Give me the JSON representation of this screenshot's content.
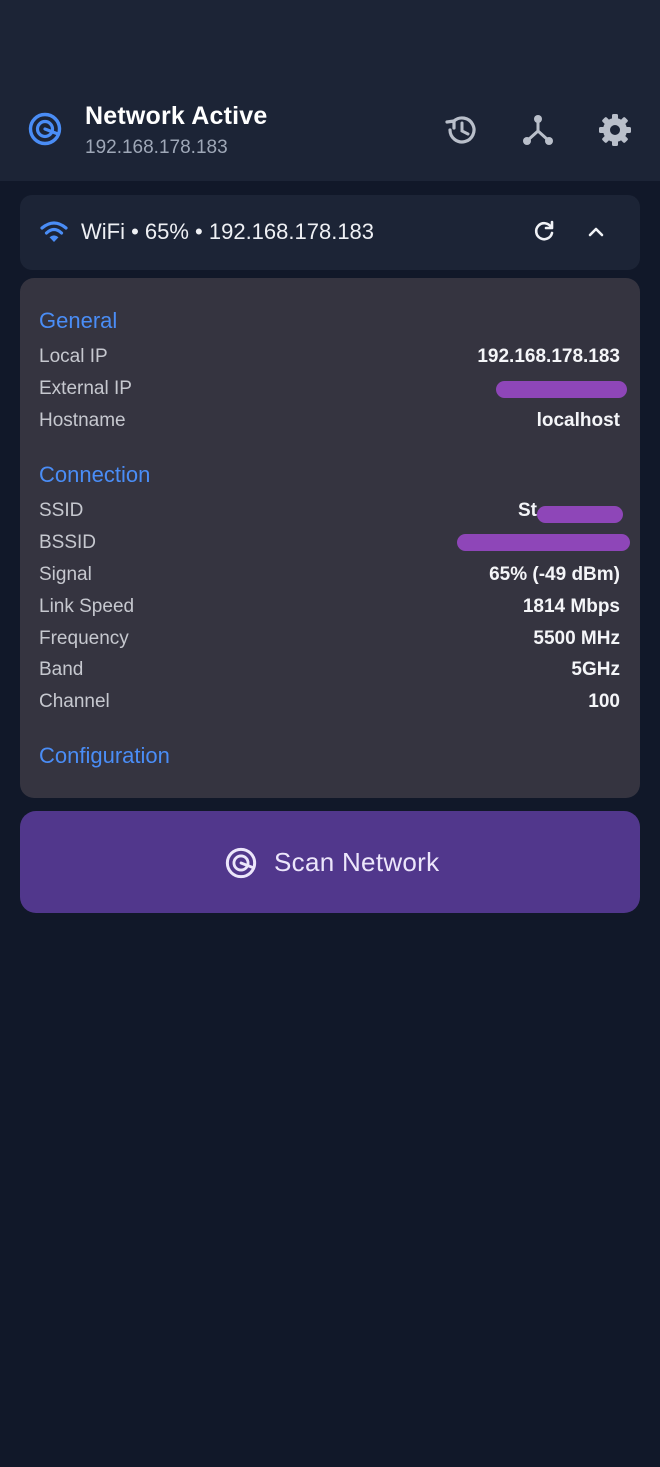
{
  "header": {
    "title": "Network Active",
    "subtitle": "192.168.178.183",
    "logo_icon": "radar-icon",
    "actions": [
      "history-icon",
      "network-topology-icon",
      "settings-icon"
    ]
  },
  "wifi": {
    "summary": "WiFi • 65% • 192.168.178.183",
    "icon": "wifi-icon",
    "refresh_icon": "refresh-icon",
    "collapse_icon": "chevron-up-icon"
  },
  "details": {
    "general_title": "General",
    "local_ip_label": "Local IP",
    "local_ip_value": "192.168.178.183",
    "external_ip_label": "External IP",
    "hostname_label": "Hostname",
    "hostname_value": "localhost",
    "connection_title": "Connection",
    "ssid_label": "SSID",
    "ssid_value_visible": "St",
    "bssid_label": "BSSID",
    "signal_label": "Signal",
    "signal_value": "65% (-49 dBm)",
    "link_speed_label": "Link Speed",
    "link_speed_value": "1814 Mbps",
    "frequency_label": "Frequency",
    "frequency_value": "5500 MHz",
    "band_label": "Band",
    "band_value": "5GHz",
    "channel_label": "Channel",
    "channel_value": "100",
    "configuration_title": "Configuration"
  },
  "scan": {
    "label": "Scan Network",
    "icon": "radar-icon"
  },
  "colors": {
    "background": "#111829",
    "appbar": "#1c2436",
    "card": "#353440",
    "accent_blue": "#4a8df6",
    "scan_button": "#51378c",
    "redaction": "#8e46b8"
  }
}
